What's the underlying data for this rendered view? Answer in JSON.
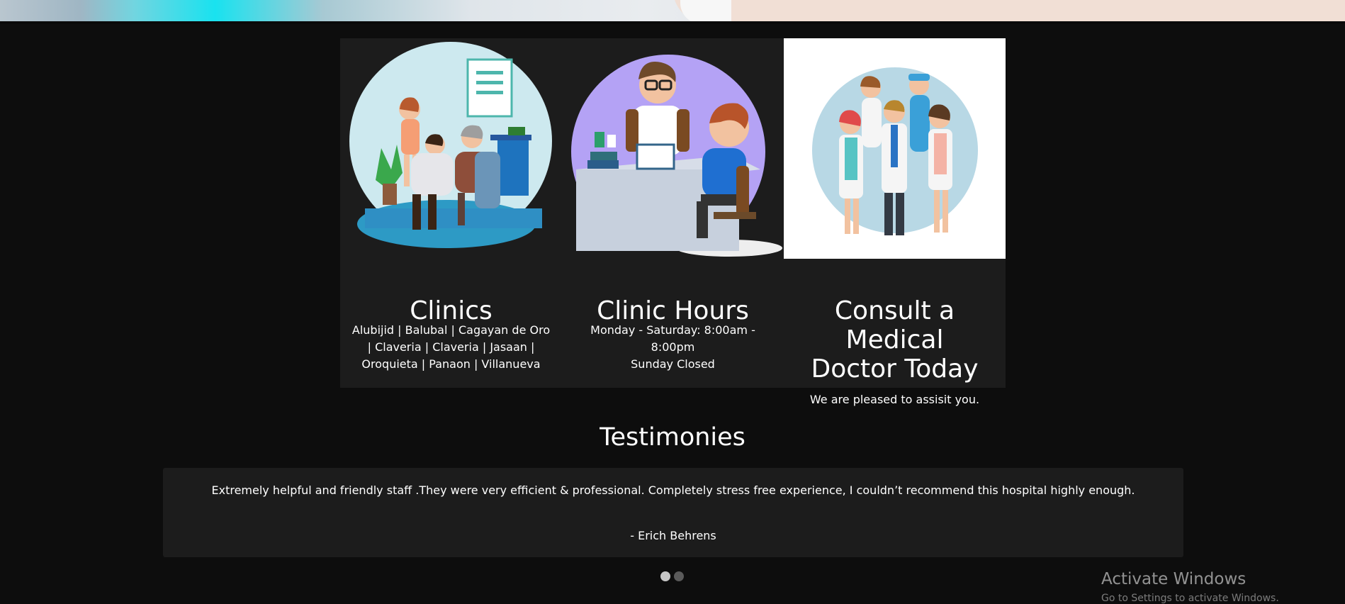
{
  "features": [
    {
      "title": "Clinics",
      "icon": "clinic-illustration-icon",
      "lines": [
        "Alubijid | Balubal | Cagayan de Oro",
        "| Claveria | Claveria | Jasaan |",
        "Oroquieta | Panaon | Villanueva"
      ]
    },
    {
      "title": "Clinic Hours",
      "icon": "doctor-desk-illustration-icon",
      "lines": [
        "Monday - Saturday: 8:00am -",
        "8:00pm",
        "Sunday Closed"
      ]
    },
    {
      "title_lines": [
        "Consult a Medical",
        "Doctor Today"
      ],
      "icon": "medical-team-illustration-icon",
      "lines": [
        "We are pleased to assisit you."
      ]
    }
  ],
  "testimonies": {
    "title": "Testimonies",
    "quote": "Extremely helpful and friendly staff .They were very efficient & professional. Completely stress free experience, I couldn’t recommend this hospital highly enough.",
    "author": "- Erich Behrens",
    "active_slide": 1,
    "slide_count": 2
  },
  "watermark": {
    "title": "Activate Windows",
    "subtitle": "Go to Settings to activate Windows."
  },
  "colors": {
    "background": "#0d0d0d",
    "card": "#1c1c1c",
    "text": "#ffffff"
  }
}
